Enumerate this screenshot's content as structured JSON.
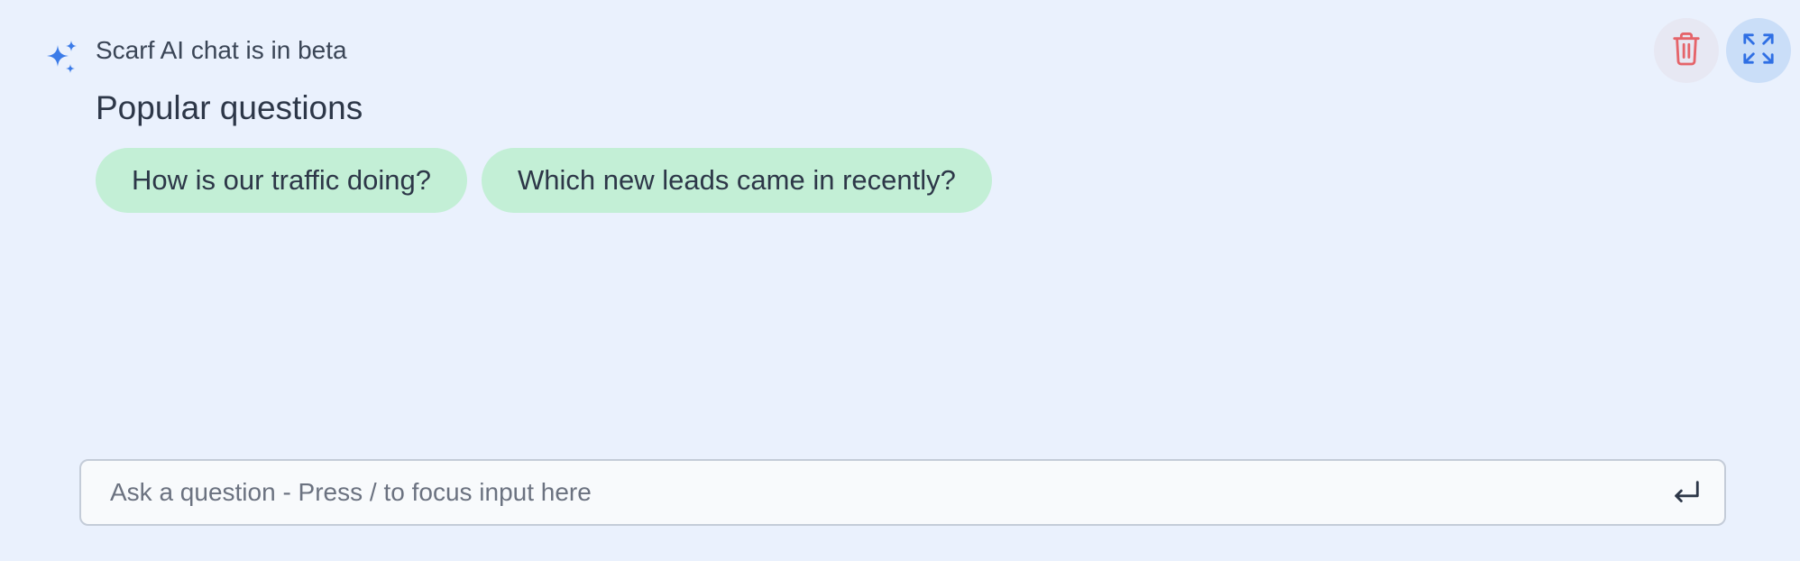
{
  "header": {
    "beta_notice": "Scarf AI chat is in beta",
    "sparkle_icon": "sparkles-icon",
    "accent_color": "#3B82F6"
  },
  "popular": {
    "title": "Popular questions",
    "questions": [
      "How is our traffic doing?",
      "Which new leads came in recently?"
    ],
    "chip_color": "#C3EFD6"
  },
  "actions": {
    "delete_icon": "trash-icon",
    "delete_color": "#E5646A",
    "expand_icon": "expand-icon",
    "expand_color": "#2F6FE4"
  },
  "chat_input": {
    "placeholder": "Ask a question - Press / to focus input here",
    "value": "",
    "submit_icon": "enter-key-icon"
  }
}
